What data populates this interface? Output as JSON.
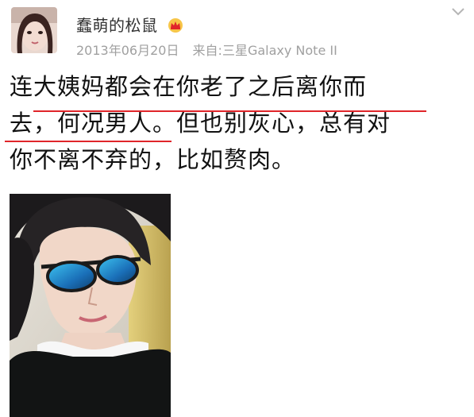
{
  "post": {
    "username": "蠢萌的松鼠",
    "badge_icon": "crown-icon",
    "date": "2013年06月20日",
    "source": "来自:三星Galaxy Note II",
    "text_lines": [
      "连大姨妈都会在你老了之后离你而",
      "去，何况男人。但也别灰心，总有对",
      "你不离不弃的，比如赘肉。"
    ],
    "highlight_color": "#e0252a",
    "image_icon": "selfie-photo"
  },
  "colors": {
    "username": "#333333",
    "meta": "#a0a0a0",
    "text": "#111111",
    "underline": "#e0252a",
    "crown": "#f2a81d"
  }
}
